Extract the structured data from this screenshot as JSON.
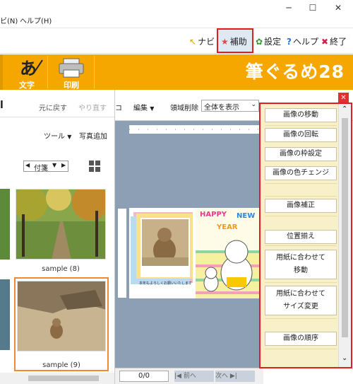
{
  "window": {
    "minimize": "─",
    "maximize": "☐",
    "close": "✕"
  },
  "menu": {
    "item1": "ビ(N)",
    "item2": "ヘルプ(H)"
  },
  "navi": {
    "navi_label": "ナビ",
    "hojo_label": "補助",
    "settei_label": "設定",
    "help_label": "ヘルプ",
    "exit_label": "終了"
  },
  "toolbar": {
    "moji_label": "文字",
    "insatsu_label": "印刷",
    "app_logo": "筆ぐるめ28"
  },
  "left_panel": {
    "title_fragment": "l",
    "undo_label": "元に戻す",
    "redo_label": "やり直す",
    "tool_label": "ツール",
    "add_photo_label": "写真追加",
    "sticky_label": "付箋",
    "photos": [
      {
        "caption": "sample (8)"
      },
      {
        "caption": "sample (9)"
      }
    ]
  },
  "editor": {
    "fragment": "コ",
    "edit_menu": "編集",
    "area_delete": "領域削除",
    "zoom_value": "全体を表示",
    "page_counter": "0/0",
    "prev_label": "前へ",
    "next_label": "次へ"
  },
  "card": {
    "greeting_line": "本年もよろしくお願いいたします",
    "happy": "HAPPY",
    "new": "NEW",
    "year": "YEAR"
  },
  "right_panel": {
    "buttons": [
      "画像の移動",
      "画像の回転",
      "画像の枠設定",
      "画像の色チェンジ",
      "画像補正",
      "位置揃え",
      "用紙に合わせて",
      "移動",
      "用紙に合わせて",
      "サイズ変更",
      "画像の順序"
    ]
  },
  "colors": {
    "orange": "#f5a700",
    "highlight_red": "#e02020",
    "canvas_bg": "#8c9fb5",
    "panel_bg": "#f7f0c8"
  }
}
